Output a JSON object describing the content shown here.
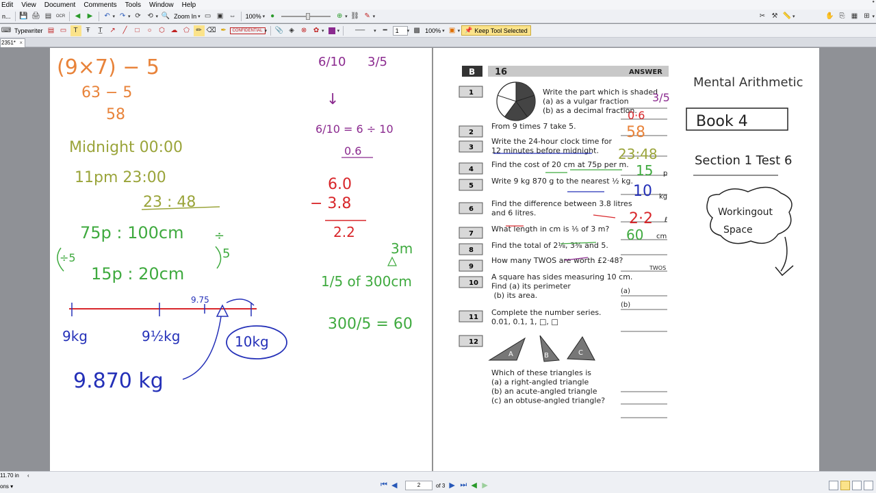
{
  "menu": [
    "Edit",
    "View",
    "Document",
    "Comments",
    "Tools",
    "Window",
    "Help"
  ],
  "toolbar1": {
    "file_label": "n...",
    "ocr_label": "OCR",
    "zoom_in_label": "Zoom In",
    "zoom_value": "100%"
  },
  "toolbar2": {
    "typewriter_label": "Typewriter",
    "confidential_label": "CONFIDENTIAL",
    "line_width": "1",
    "opacity": "100%",
    "keep_tool_label": "Keep Tool Selected"
  },
  "tab": {
    "title": "2351*",
    "close": "×"
  },
  "status": {
    "size": "11.70 in",
    "options": "ons"
  },
  "nav": {
    "page": "2",
    "of_total": "of 3"
  },
  "whiteboard_left": {
    "calc1": "(9×7) − 5",
    "calc2": "63   − 5",
    "calc3": "58",
    "midnight": "Midnight  00:00",
    "pm11": "11pm   23:00",
    "answer_time": "23 : 48",
    "ratio1": "75p : 100cm",
    "ratio_div": "÷",
    "ratio_div5a": "÷5",
    "ratio_div5b": "5",
    "ratio2": "15p : 20cm",
    "label_9kg": "9kg",
    "label_9half": "9½kg",
    "label_9_75": "9.75",
    "label_10kg": "10kg",
    "answer_kg": "9.870 kg"
  },
  "whiteboard_mid": {
    "frac_6_10": "6/10",
    "frac_3_5": "3/5",
    "arrow": "↓",
    "frac_work": "6/10  =  6 ÷ 10",
    "decimal": "0.6",
    "sub_top": "6.0",
    "sub_mid": "− 3.8",
    "sub_res": "2.2",
    "label_3m": "3m",
    "frac_300": "1/5 of 300cm",
    "div_300": "300/5  =  60"
  },
  "worksheet": {
    "header_code": "B",
    "header_num": "16",
    "answer_header": "ANSWER",
    "questions": [
      {
        "n": "1",
        "text": "Write the part which is shaded\n(a) as a vulgar fraction\n(b) as a decimal fraction."
      },
      {
        "n": "2",
        "text": "From 9 times 7 take 5."
      },
      {
        "n": "3",
        "text": "Write the 24-hour clock time for\n12 minutes before midnight."
      },
      {
        "n": "4",
        "text": "Find the cost of 20 cm at 75p per m."
      },
      {
        "n": "5",
        "text": "Write 9 kg 870 g to the nearest ½ kg."
      },
      {
        "n": "6",
        "text": "Find the difference between 3.8 litres\nand 6 litres."
      },
      {
        "n": "7",
        "text": "What length in cm is ⅕ of 3 m?"
      },
      {
        "n": "8",
        "text": "Find the total of 2⅛, 3⅜ and 5."
      },
      {
        "n": "9",
        "text": "How many TWOS are worth £2·48?"
      },
      {
        "n": "10",
        "text": "A square has sides measuring 10 cm.\nFind (a) its perimeter\n        (b) its area."
      },
      {
        "n": "11",
        "text": "Complete the number series.\n0.01, 0.1, 1, □, □"
      },
      {
        "n": "12",
        "text": "Which of these triangles is\n(a) a right-angled triangle\n(b) an acute-angled triangle\n(c) an obtuse-angled triangle?"
      }
    ],
    "answers": {
      "a1a": "3/5",
      "a1b": "0·6",
      "a2": "58",
      "a3": "23:48",
      "a4": "15",
      "a4_unit": "p",
      "a5": "10",
      "a5_unit": "kg",
      "a6": "2·2",
      "a6_unit": "ℓ",
      "a7": "60",
      "a7_unit": "cm",
      "a9_unit": "TWOS",
      "a10a": "(a)",
      "a10b": "(b)"
    },
    "triangle_labels": [
      "A",
      "B",
      "C"
    ]
  },
  "right_notes": {
    "title1": "Mental Arithmetic",
    "book": "Book 4",
    "section": "Section 1 Test 6",
    "cloud": "Working out Space"
  },
  "colors": {
    "orange": "#e8833a",
    "olive": "#9aa43a",
    "green": "#3faa3f",
    "purple": "#8b2a8f",
    "red": "#d8262a",
    "blue": "#2430b8",
    "black": "#222222",
    "highlight": "#fbe38a"
  }
}
